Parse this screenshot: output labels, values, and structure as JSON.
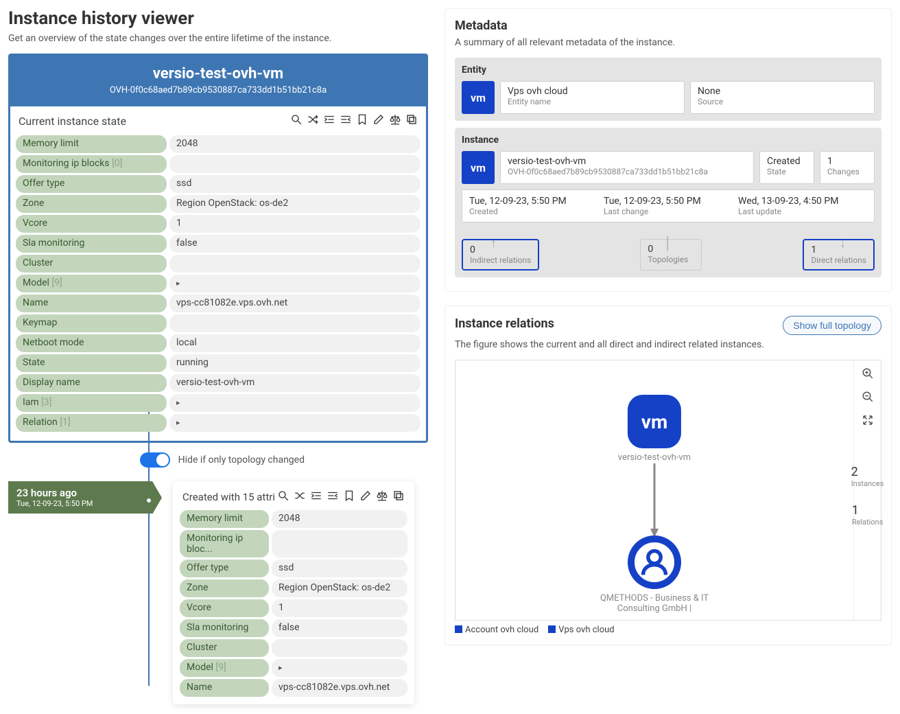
{
  "header": {
    "title": "Instance history viewer",
    "subtitle": "Get an overview of the state changes over the entire lifetime of the instance."
  },
  "instance": {
    "name": "versio-test-ovh-vm",
    "id": "OVH-0f0c68aed7b89cb9530887ca733dd1b51bb21c8a",
    "state_label": "Current instance state",
    "props": [
      {
        "key": "Memory limit",
        "val": "2048"
      },
      {
        "key": "Monitoring ip blocks",
        "cnt": "[0]",
        "val": ""
      },
      {
        "key": "Offer type",
        "val": "ssd"
      },
      {
        "key": "Zone",
        "val": "Region OpenStack: os-de2"
      },
      {
        "key": "Vcore",
        "val": "1"
      },
      {
        "key": "Sla monitoring",
        "val": "false"
      },
      {
        "key": "Cluster",
        "val": ""
      },
      {
        "key": "Model",
        "cnt": "[9]",
        "expand": true
      },
      {
        "key": "Name",
        "val": "vps-cc81082e.vps.ovh.net"
      },
      {
        "key": "Keymap",
        "val": ""
      },
      {
        "key": "Netboot mode",
        "val": "local"
      },
      {
        "key": "State",
        "val": "running"
      },
      {
        "key": "Display name",
        "val": "versio-test-ovh-vm"
      },
      {
        "key": "Iam",
        "cnt": "[3]",
        "expand": true
      },
      {
        "key": "Relation",
        "cnt": "[1]",
        "expand": true
      }
    ]
  },
  "toggle": {
    "label": "Hide if only topology changed"
  },
  "timeline": {
    "ago": "23 hours ago",
    "time": "Tue, 12-09-23, 5:50 PM",
    "card_label": "Created with 15 attri",
    "props": [
      {
        "key": "Memory limit",
        "val": "2048"
      },
      {
        "key": "Monitoring ip bloc...",
        "val": ""
      },
      {
        "key": "Offer type",
        "val": "ssd"
      },
      {
        "key": "Zone",
        "val": "Region OpenStack: os-de2"
      },
      {
        "key": "Vcore",
        "val": "1"
      },
      {
        "key": "Sla monitoring",
        "val": "false"
      },
      {
        "key": "Cluster",
        "val": ""
      },
      {
        "key": "Model",
        "cnt": "[9]",
        "expand": true
      },
      {
        "key": "Name",
        "val": "vps-cc81082e.vps.ovh.net"
      }
    ]
  },
  "metadata": {
    "title": "Metadata",
    "subtitle": "A summary of all relevant metadata of the instance.",
    "entity": {
      "label": "Entity",
      "name": "Vps ovh cloud",
      "name_sub": "Entity name",
      "source": "None",
      "source_sub": "Source"
    },
    "inst": {
      "label": "Instance",
      "name": "versio-test-ovh-vm",
      "id": "OVH-0f0c68aed7b89cb9530887ca733dd1b51bb21c8a",
      "state": "Created",
      "state_sub": "State",
      "changes": "1",
      "changes_sub": "Changes",
      "ts": [
        {
          "v": "Tue, 12-09-23, 5:50 PM",
          "s": "Created"
        },
        {
          "v": "Tue, 12-09-23, 5:50 PM",
          "s": "Last change"
        },
        {
          "v": "Wed, 13-09-23, 4:50 PM",
          "s": "Last update"
        }
      ],
      "counts": [
        {
          "v": "0",
          "s": "Indirect relations",
          "active": true
        },
        {
          "v": "0",
          "s": "Topologies"
        },
        {
          "v": "1",
          "s": "Direct relations",
          "active": true
        }
      ]
    }
  },
  "relations": {
    "title": "Instance relations",
    "btn": "Show full topology",
    "subtitle": "The figure shows the current and all direct and indirect related instances.",
    "node1": "versio-test-ovh-vm",
    "node2": "QMETHODS - Business & IT Consulting GmbH |",
    "instances": "2",
    "instances_lbl": "Instances",
    "rels": "1",
    "rels_lbl": "Relations",
    "legend": [
      {
        "c": "#1541c6",
        "t": "Account ovh cloud"
      },
      {
        "c": "#1541c6",
        "t": "Vps ovh cloud"
      }
    ]
  }
}
